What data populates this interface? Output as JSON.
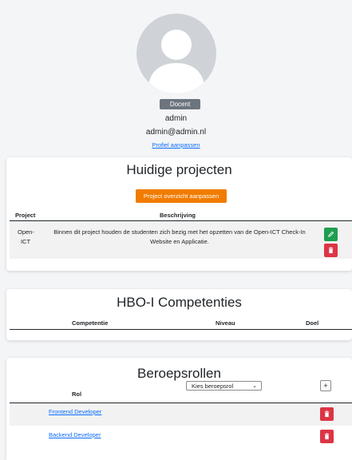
{
  "profile": {
    "role_badge": "Docent",
    "username": "admin",
    "email": "admin@admin.nl",
    "edit_link": "Profiel aanpassen"
  },
  "projects": {
    "title": "Huidige projecten",
    "edit_button": "Project overzicht aanpassen",
    "columns": [
      "Project",
      "Beschrijving"
    ],
    "rows": [
      {
        "project": "Open-ICT",
        "description": "Binnen dit project houden de studenten zich bezig met het opzetten van de Open-ICT Check-In Website en Applicatie."
      }
    ]
  },
  "competencies": {
    "title": "HBO-I Competenties",
    "columns": [
      "Competentie",
      "Niveau",
      "Doel"
    ]
  },
  "roles": {
    "title": "Beroepsrollen",
    "column": "Rol",
    "select_value": "Kies beroepsrol",
    "add_label": "+",
    "items": [
      "Frontend Developer",
      "Backend Developer"
    ]
  },
  "colors": {
    "primary_orange": "#f07c00",
    "danger": "#dc3545",
    "success": "#1e9e4e",
    "link": "#0d6efd"
  }
}
